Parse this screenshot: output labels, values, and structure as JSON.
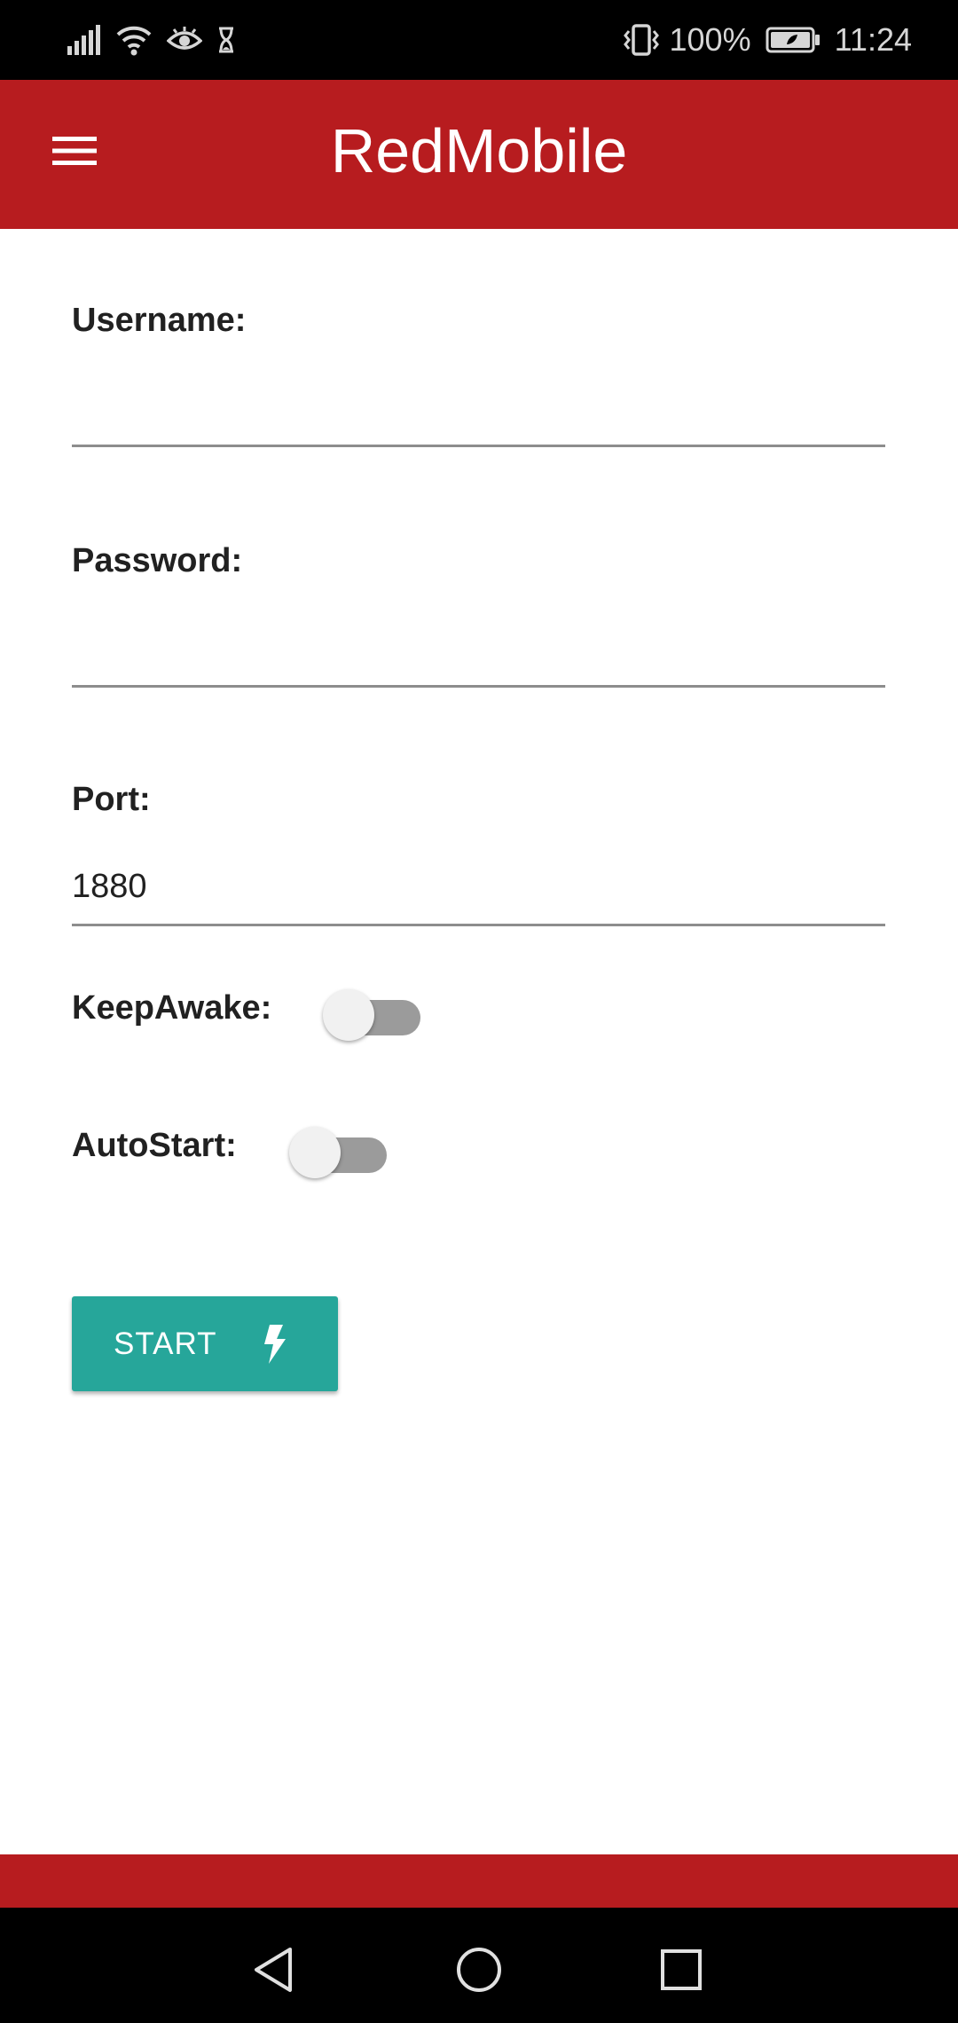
{
  "status_bar": {
    "battery_percent": "100%",
    "time": "11:24",
    "icons": [
      "signal-icon",
      "wifi-icon",
      "eye-icon",
      "hourglass-icon",
      "vibrate-icon",
      "battery-icon"
    ]
  },
  "app_bar": {
    "title": "RedMobile",
    "menu_icon": "menu-icon"
  },
  "form": {
    "username": {
      "label": "Username:",
      "value": ""
    },
    "password": {
      "label": "Password:",
      "value": ""
    },
    "port": {
      "label": "Port:",
      "value": "1880"
    },
    "keep_awake": {
      "label": "KeepAwake:",
      "enabled": false
    },
    "auto_start": {
      "label": "AutoStart:",
      "enabled": false
    },
    "start_button": {
      "label": "START",
      "icon": "bolt-icon"
    }
  },
  "colors": {
    "primary": "#b71c1f",
    "accent": "#26a69a",
    "toggle_track_off": "#9b9b9b",
    "toggle_thumb_off": "#f1f1f1"
  },
  "nav_bar": {
    "buttons": [
      "back-icon",
      "home-icon",
      "recents-icon"
    ]
  }
}
